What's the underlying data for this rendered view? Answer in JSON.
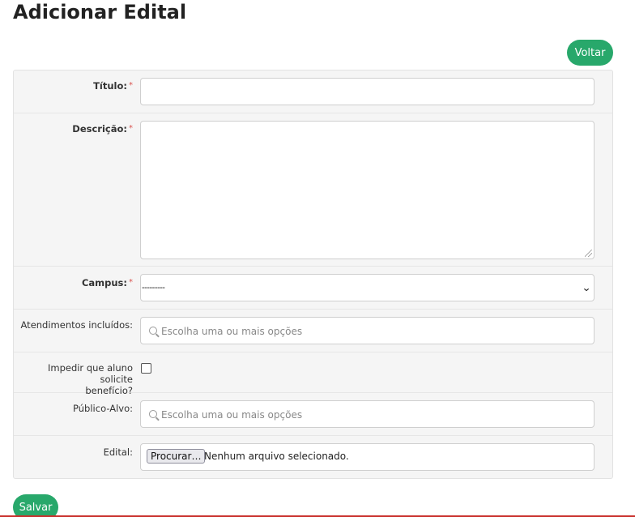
{
  "page": {
    "title": "Adicionar Edital"
  },
  "actions": {
    "back_label": "Voltar",
    "save_label": "Salvar"
  },
  "colors": {
    "accent": "#28a86b",
    "required_mark": "#d9534f",
    "panel_bg": "#f5f5f5"
  },
  "form": {
    "titulo": {
      "label": "Título:",
      "required_mark": "*",
      "value": ""
    },
    "descricao": {
      "label": "Descrição:",
      "required_mark": "*",
      "value": ""
    },
    "campus": {
      "label": "Campus:",
      "required_mark": "*",
      "selected": "---------"
    },
    "atendimentos": {
      "label": "Atendimentos incluídos:",
      "placeholder": "Escolha uma ou mais opções",
      "icon": "search-icon"
    },
    "impedir": {
      "label_line1": "Impedir que aluno solicite",
      "label_line2": "benefício?",
      "checked": false
    },
    "publico": {
      "label": "Público-Alvo:",
      "placeholder": "Escolha uma ou mais opções",
      "icon": "search-icon"
    },
    "edital": {
      "label": "Edital:",
      "button_label": "Procurar…",
      "status": "Nenhum arquivo selecionado."
    }
  }
}
